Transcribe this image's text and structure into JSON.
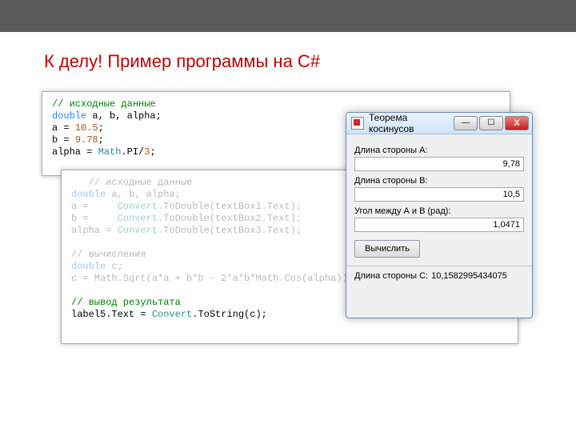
{
  "title": "К делу! Пример программы на C#",
  "code1": {
    "comment": "// исходные данные",
    "decl_kw": "double",
    "decl_rest": " a, b, alpha;",
    "l3a": "a = ",
    "l3n": "10.5",
    "l3b": ";",
    "l4a": "b = ",
    "l4n": "9.78",
    "l4b": ";",
    "l5a": "alpha = ",
    "l5c": "Math",
    "l5b": ".PI/",
    "l5n": "3",
    "l5d": ";"
  },
  "code2": {
    "c1": "   // исходные данные",
    "l2a": "double",
    "l2b": " a, b, alpha;",
    "l3a": "a =     ",
    "l3c": "Convert",
    "l3b": ".ToDouble(textBox1.Text);",
    "l4a": "b =     ",
    "l4c": "Convert",
    "l4b": ".ToDouble(textBox2.Text);",
    "l5a": "alpha = ",
    "l5c": "Convert",
    "l5b": ".ToDouble(textBox3.Text);",
    "c2": "// вычисления",
    "l7a": "double",
    "l7b": " c;",
    "l8": "c = Math.Sqrt(a*a + b*b - 2*a*b*Math.Cos(alpha));",
    "c3": "// вывод результата",
    "l10a": "label5.Text = ",
    "l10c": "Convert",
    "l10b": ".ToString(c);"
  },
  "form": {
    "caption": "Теорема косинусов",
    "labelA": "Длина стороны А:",
    "valA": "9,78",
    "labelB": "Длина стороны B:",
    "valB": "10,5",
    "labelAngle": "Угол между А и В (рад):",
    "valAngle": "1,0471",
    "calc": "Вычислить",
    "labelC": "Длина стороны C:",
    "valC": "10,1582995434075"
  }
}
